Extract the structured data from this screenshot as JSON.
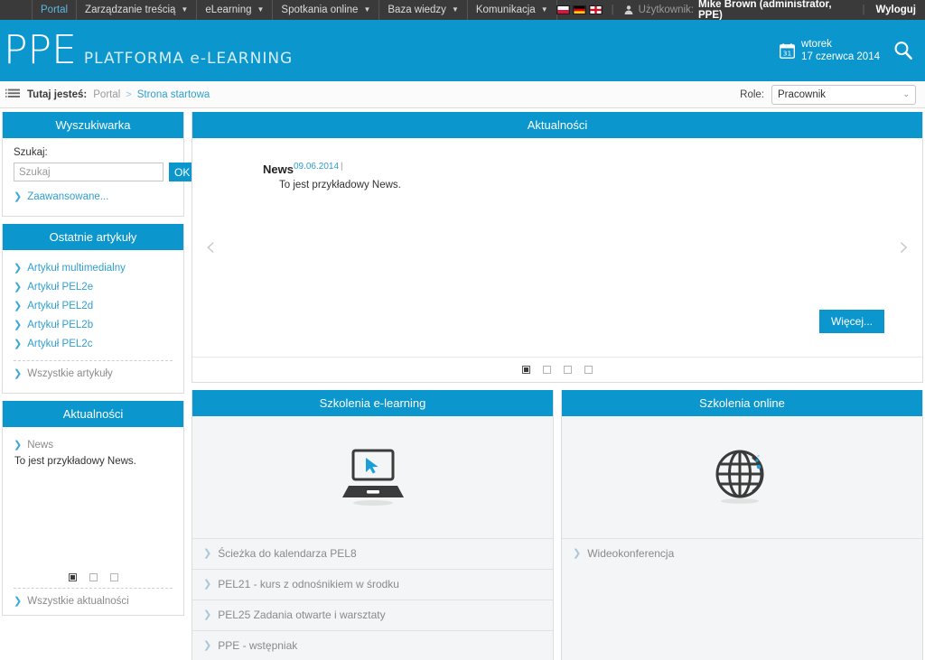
{
  "topbar": {
    "nav": [
      {
        "label": "Portal",
        "has_caret": false,
        "active": true
      },
      {
        "label": "Zarządzanie treścią",
        "has_caret": true,
        "active": false
      },
      {
        "label": "eLearning",
        "has_caret": true,
        "active": false
      },
      {
        "label": "Spotkania online",
        "has_caret": true,
        "active": false
      },
      {
        "label": "Baza wiedzy",
        "has_caret": true,
        "active": false
      },
      {
        "label": "Komunikacja",
        "has_caret": true,
        "active": false
      }
    ],
    "flags": [
      {
        "name": "flag-poland",
        "title": "Polski"
      },
      {
        "name": "flag-germany",
        "title": "Deutsch"
      },
      {
        "name": "flag-england",
        "title": "English"
      }
    ],
    "user_label": "Użytkownik:",
    "user_name": "Mike Brown (administrator, PPE)",
    "logout": "Wyloguj",
    "separator": "|"
  },
  "header": {
    "brand_main": "PPE",
    "brand_sub": "PLATFORMA e-LEARNING",
    "calendar_day": "31",
    "date_weekday": "wtorek",
    "date_full": "17 czerwca 2014"
  },
  "breadcrumb": {
    "label": "Tutaj jesteś:",
    "root": "Portal",
    "separator": ">",
    "current": "Strona startowa",
    "role_label": "Role:",
    "role_value": "Pracownik"
  },
  "sidebar": {
    "search": {
      "title": "Wyszukiwarka",
      "field_label": "Szukaj:",
      "input_value": "",
      "placeholder": "Szukaj",
      "ok_label": "OK",
      "advanced_label": "Zaawansowane..."
    },
    "articles": {
      "title": "Ostatnie artykuły",
      "items": [
        {
          "label": "Artykuł multimedialny"
        },
        {
          "label": "Artykuł PEL2e"
        },
        {
          "label": "Artykuł PEL2d"
        },
        {
          "label": "Artykuł PEL2b"
        },
        {
          "label": "Artykuł PEL2c"
        }
      ],
      "all_label": "Wszystkie artykuły"
    },
    "news": {
      "title": "Aktualności",
      "item_label": "News",
      "item_text": "To jest przykładowy News.",
      "pager": [
        {
          "active": true
        },
        {
          "active": false
        },
        {
          "active": false
        }
      ],
      "all_label": "Wszystkie aktualności"
    }
  },
  "main": {
    "news_panel": {
      "title": "Aktualności",
      "news_name": "News",
      "news_date": "09.06.2014",
      "news_pipe": "|",
      "news_text": "To jest przykładowy News.",
      "more_label": "Więcej...",
      "prev_arrow": "‹",
      "next_arrow": "›",
      "pager": [
        {
          "active": true
        },
        {
          "active": false
        },
        {
          "active": false
        },
        {
          "active": false
        }
      ]
    },
    "elearning_panel": {
      "title": "Szkolenia e-learning",
      "icon": "laptop-cursor-icon",
      "items": [
        {
          "label": "Ścieżka do kalendarza PEL8"
        },
        {
          "label": "PEL21 - kurs z odnośnikiem w środku"
        },
        {
          "label": "PEL25 Zadania otwarte i warsztaty"
        },
        {
          "label": "PPE - wstępniak"
        }
      ]
    },
    "online_panel": {
      "title": "Szkolenia online",
      "icon": "globe-icon",
      "items": [
        {
          "label": "Wideokonferencja"
        }
      ]
    }
  },
  "colors": {
    "brand_blue": "#0b97cd",
    "topbar_dark": "#3a3a3a",
    "link_blue": "#2f9fd0",
    "muted_grey": "#8a8a8a",
    "panel_grey": "#f4f5f6"
  }
}
